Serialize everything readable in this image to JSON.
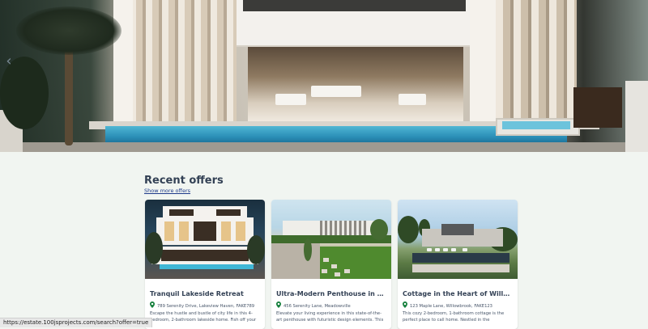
{
  "hero": {
    "prev_icon": "chevron-left-icon",
    "prev_glyph": "‹"
  },
  "recent": {
    "title": "Recent offers",
    "show_more": "Show more offers"
  },
  "offers": [
    {
      "title": "Tranquil Lakeside Retreat",
      "address": "789 Serenity Drive, Lakeview Haven, FAKE789",
      "description": "Escape the hustle and bustle of city life in this 4-bedroom, 2-bathroom lakeside home. Fish off your o...",
      "icon": "location-pin-icon"
    },
    {
      "title": "Ultra-Modern Penthouse in the C...",
      "address": "456 Serenity Lane, Meadowville",
      "description": "Elevate your living experience in this state-of-the-art penthouse with futuristic design elements. This high-...",
      "icon": "location-pin-icon"
    },
    {
      "title": "Cottage in the Heart of Willow",
      "address": "123 Maple Lane, Willowbrook, FAKE123",
      "description": "This cozy 2-bedroom, 1-bathroom cottage is the perfect place to call home. Nestled in the picturesque...",
      "icon": "location-pin-icon"
    }
  ],
  "status_bar": {
    "url": "https://estate.100jsprojects.com/search?offer=true"
  },
  "colors": {
    "background": "#f1f5f1",
    "heading": "#334155",
    "link": "#1e3a8a",
    "pin": "#15803d"
  }
}
